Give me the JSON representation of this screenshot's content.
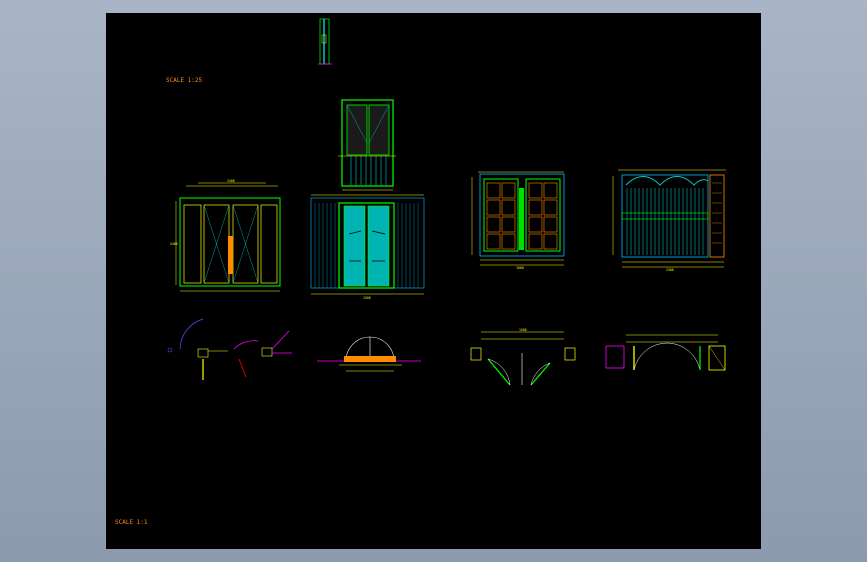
{
  "drawing": {
    "scale_top": "SCALE 1:25",
    "scale_bottom": "SCALE 1:1"
  },
  "colors": {
    "background": "#000000",
    "frame": "#00ff00",
    "dimension": "#ffff00",
    "glass": "#00c8c8",
    "hatch": "#00bfff",
    "handle": "#ff8c00",
    "wall": "#ff00ff",
    "label": "#ff8a1a"
  }
}
